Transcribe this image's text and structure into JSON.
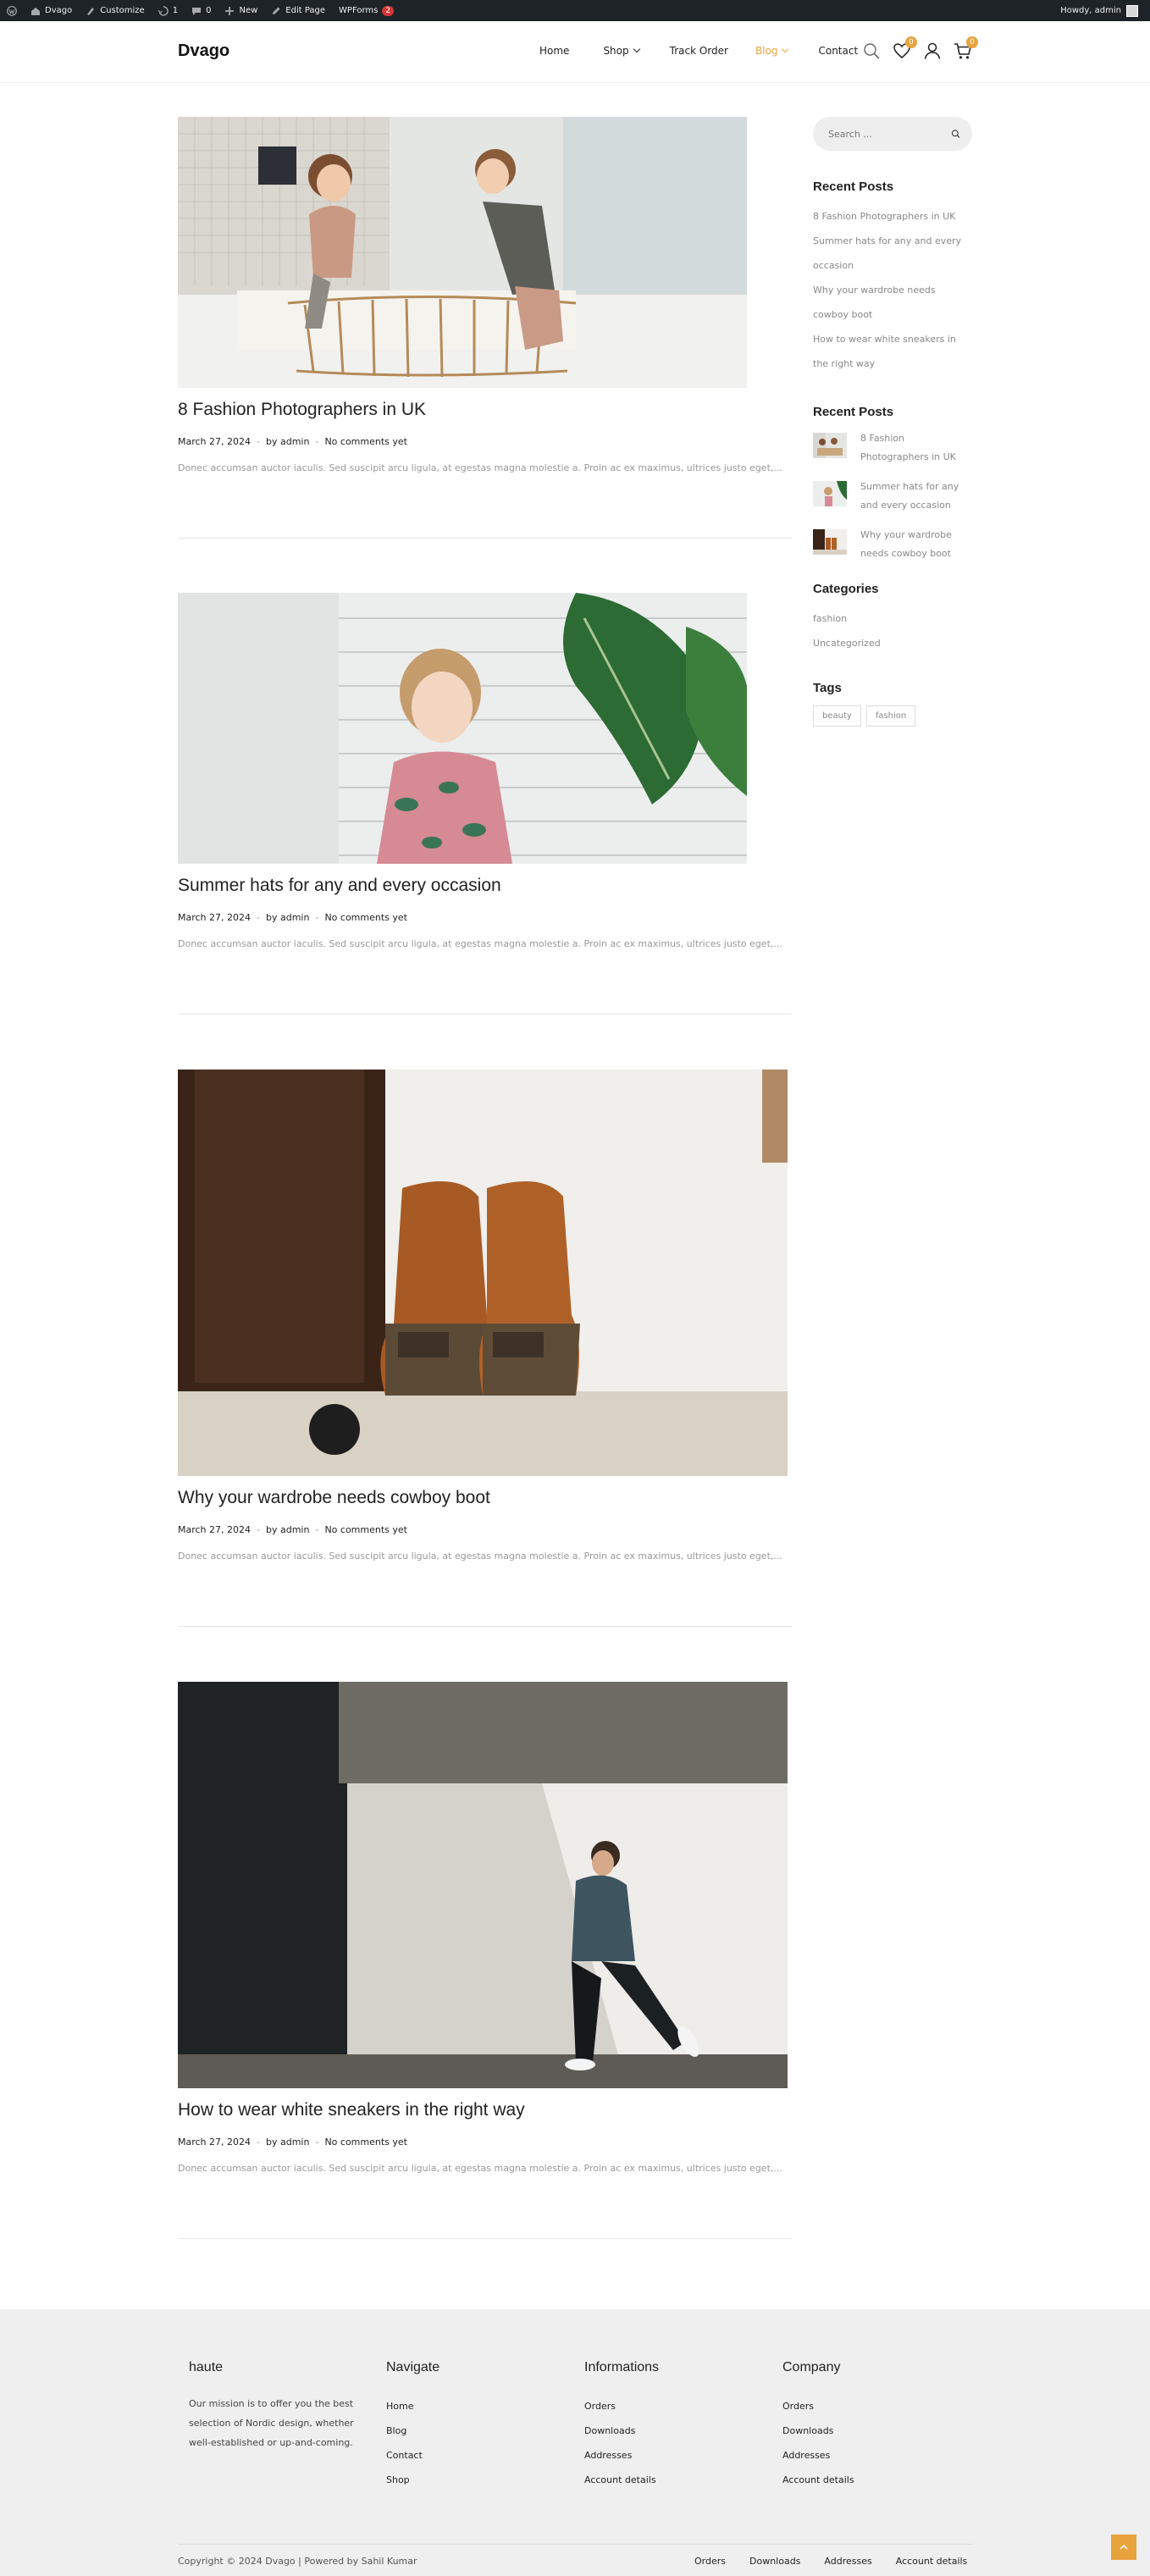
{
  "adminbar": {
    "site": "Dvago",
    "customize": "Customize",
    "updates": "1",
    "comments": "0",
    "new": "New",
    "edit_page": "Edit Page",
    "wpforms": "WPForms",
    "wpforms_count": "2",
    "howdy": "Howdy, admin"
  },
  "header": {
    "logo": "Dvago",
    "nav": [
      {
        "label": "Home"
      },
      {
        "label": "Shop"
      },
      {
        "label": "Track Order"
      },
      {
        "label": "Blog"
      },
      {
        "label": "Contact"
      }
    ],
    "wishlist_count": "0",
    "cart_count": "0",
    "accent": "#e8a33d"
  },
  "posts": [
    {
      "title": "8 Fashion Photographers in UK",
      "date": "March 27, 2024",
      "by": "by admin",
      "comments": "No comments yet",
      "excerpt": "Donec accumsan auctor iaculis. Sed suscipit arcu ligula, at egestas magna molestie a. Proin ac ex maximus, ultrices justo eget,..."
    },
    {
      "title": "Summer hats for any and every occasion",
      "date": "March 27, 2024",
      "by": "by admin",
      "comments": "No comments yet",
      "excerpt": "Donec accumsan auctor iaculis. Sed suscipit arcu ligula, at egestas magna molestie a. Proin ac ex maximus, ultrices justo eget,..."
    },
    {
      "title": "Why your wardrobe needs cowboy boot",
      "date": "March 27, 2024",
      "by": "by admin",
      "comments": "No comments yet",
      "excerpt": "Donec accumsan auctor iaculis. Sed suscipit arcu ligula, at egestas magna molestie a. Proin ac ex maximus, ultrices justo eget,..."
    },
    {
      "title": "How to wear white sneakers in the right way",
      "date": "March 27, 2024",
      "by": "by admin",
      "comments": "No comments yet",
      "excerpt": "Donec accumsan auctor iaculis. Sed suscipit arcu ligula, at egestas magna molestie a. Proin ac ex maximus, ultrices justo eget,..."
    }
  ],
  "sidebar": {
    "search_placeholder": "Search ...",
    "recent_posts_title": "Recent Posts",
    "recent_posts": [
      "8 Fashion Photographers in UK",
      "Summer hats for any and every occasion",
      "Why your wardrobe needs cowboy boot",
      "How to wear white sneakers in the right way"
    ],
    "recent_posts_thumbs_title": "Recent Posts",
    "recent_posts_thumbs": [
      "8 Fashion Photographers in UK",
      "Summer hats for any and every occasion",
      "Why your wardrobe needs cowboy boot"
    ],
    "categories_title": "Categories",
    "categories": [
      "fashion",
      "Uncategorized"
    ],
    "tags_title": "Tags",
    "tags": [
      "beauty",
      "fashion"
    ]
  },
  "footer": {
    "brand_title": "haute",
    "mission": "Our mission is to offer you the best selection of Nordic design, whether well-established or up-and-coming.",
    "navigate_title": "Navigate",
    "navigate": [
      "Home",
      "Blog",
      "Contact",
      "Shop"
    ],
    "info_title": "Informations",
    "info": [
      "Orders",
      "Downloads",
      "Addresses",
      "Account details"
    ],
    "company_title": "Company",
    "company": [
      "Orders",
      "Downloads",
      "Addresses",
      "Account details"
    ],
    "copyright": "Copyright © 2024 Dvago | Powered by Sahil Kumar",
    "bottom_links": [
      "Orders",
      "Downloads",
      "Addresses",
      "Account details"
    ]
  }
}
